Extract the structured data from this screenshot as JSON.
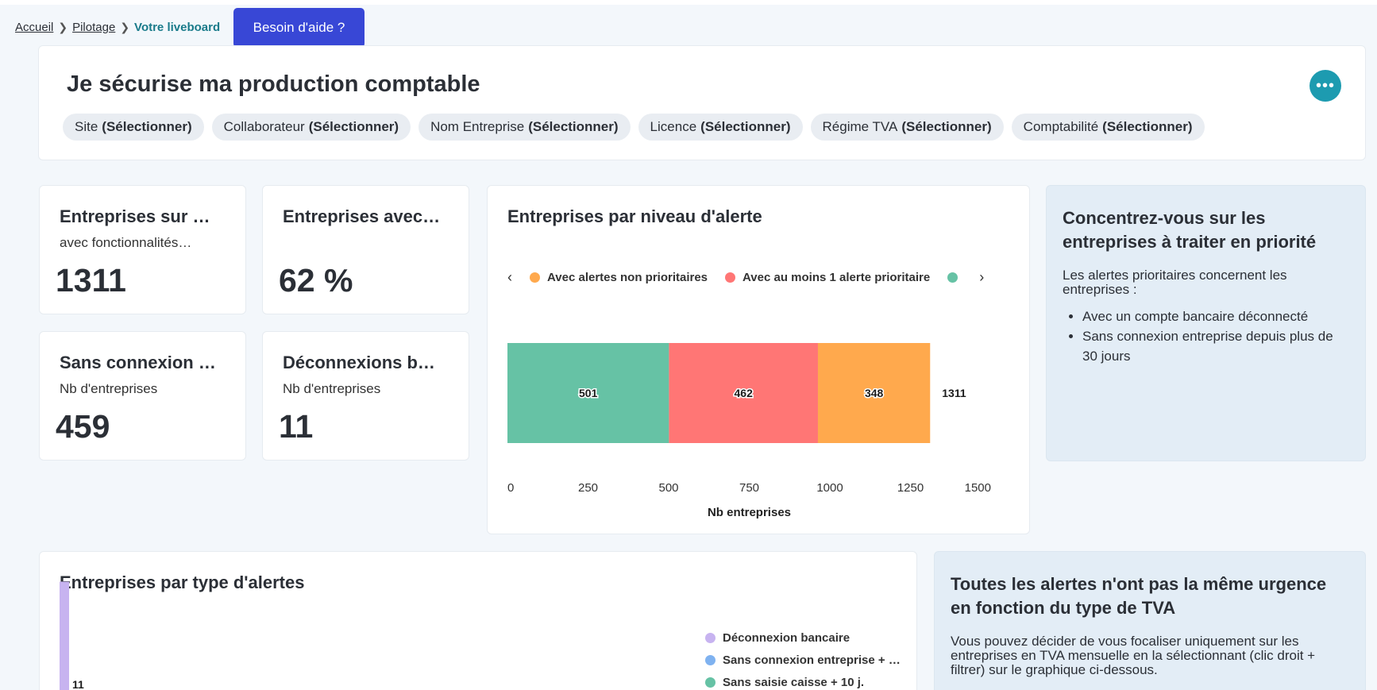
{
  "breadcrumb": {
    "items": [
      "Accueil",
      "Pilotage"
    ],
    "current": "Votre liveboard"
  },
  "help_button": "Besoin d'aide ?",
  "header": {
    "title": "Je sécurise ma production comptable",
    "more_icon": "ellipsis-icon",
    "filters": [
      {
        "label": "Site",
        "value": "(Sélectionner)"
      },
      {
        "label": "Collaborateur",
        "value": "(Sélectionner)"
      },
      {
        "label": "Nom Entreprise",
        "value": "(Sélectionner)"
      },
      {
        "label": "Licence",
        "value": "(Sélectionner)"
      },
      {
        "label": "Régime TVA",
        "value": "(Sélectionner)"
      },
      {
        "label": "Comptabilité",
        "value": "(Sélectionner)"
      }
    ]
  },
  "kpis": [
    {
      "title": "Entreprises sur …",
      "subtitle": "avec fonctionnalités…",
      "value": "1311"
    },
    {
      "title": "Entreprises avec…",
      "subtitle": "",
      "value": "62 %"
    },
    {
      "title": "Sans connexion …",
      "subtitle": "Nb d'entreprises",
      "value": "459"
    },
    {
      "title": "Déconnexions b…",
      "subtitle": "Nb d'entreprises",
      "value": "11"
    }
  ],
  "alert_chart": {
    "title": "Entreprises par niveau d'alerte",
    "legend": [
      {
        "label": "Avec alertes non prioritaires",
        "color": "#ffa94d"
      },
      {
        "label": "Avec au moins 1 alerte prioritaire",
        "color": "#ff7675"
      },
      {
        "label": "",
        "color": "#66c2a5"
      }
    ]
  },
  "chart_data": [
    {
      "type": "bar",
      "orientation": "horizontal",
      "stacked": true,
      "title": "Entreprises par niveau d'alerte",
      "xlabel": "Nb entreprises",
      "xlim": [
        0,
        1500
      ],
      "xticks": [
        0,
        250,
        500,
        750,
        1000,
        1250,
        1500
      ],
      "series": [
        {
          "color": "#66c2a5",
          "values": [
            501
          ]
        },
        {
          "name": "Avec au moins 1 alerte prioritaire",
          "color": "#ff7675",
          "values": [
            462
          ]
        },
        {
          "name": "Avec alertes non prioritaires",
          "color": "#ffa94d",
          "values": [
            348
          ]
        }
      ],
      "total_label": "1311",
      "legend_position": "top"
    },
    {
      "type": "bar",
      "title": "Entreprises par type d'alertes",
      "series": [
        {
          "name": "Déconnexion bancaire",
          "color": "#c7b3f0",
          "values": [
            11
          ]
        },
        {
          "name": "Sans connexion entreprise + …",
          "color": "#7fb2f0"
        },
        {
          "name": "Sans saisie caisse + 10 j.",
          "color": "#66c2a5"
        }
      ],
      "legend_position": "right"
    }
  ],
  "info_priority": {
    "title": "Concentrez-vous sur les entreprises à traiter en priorité",
    "text": "Les alertes prioritaires concernent les entreprises :",
    "bullets": [
      "Avec un compte bancaire déconnecté",
      "Sans connexion entreprise depuis plus de 30 jours"
    ]
  },
  "type_chart": {
    "title": "Entreprises par type d'alertes"
  },
  "info_tva": {
    "title": "Toutes les alertes n'ont pas la même urgence en fonction du type de TVA",
    "text": "Vous pouvez décider de vous focaliser uniquement sur les entreprises en TVA mensuelle en la sélectionnant (clic droit + filtrer) sur le graphique ci-dessous."
  }
}
